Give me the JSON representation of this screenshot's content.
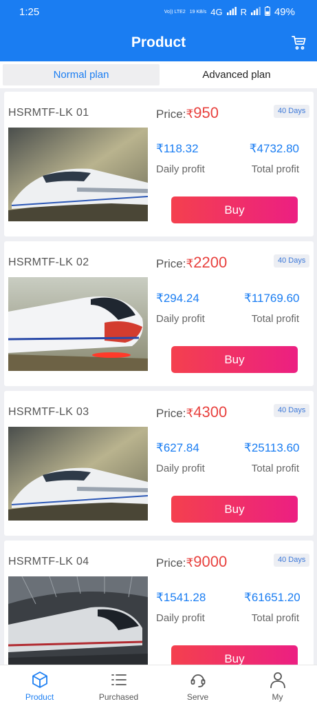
{
  "status": {
    "time": "1:25",
    "volte": "Vo)) LTE2",
    "speed": "19 KB/s",
    "network": "4G",
    "roaming": "R",
    "battery": "49%"
  },
  "header": {
    "title": "Product",
    "cart_icon": "cart-icon"
  },
  "tabs": [
    {
      "label": "Normal plan",
      "active": true
    },
    {
      "label": "Advanced plan",
      "active": false
    }
  ],
  "currency": "₹",
  "products": [
    {
      "name": "HSRMTF-LK 01",
      "price_label": "Price:",
      "price": "950",
      "days": "40 Days",
      "daily_profit": "118.32",
      "total_profit": "4732.80",
      "daily_label": "Daily profit",
      "total_label": "Total profit",
      "buy_label": "Buy"
    },
    {
      "name": "HSRMTF-LK 02",
      "price_label": "Price:",
      "price": "2200",
      "days": "40 Days",
      "daily_profit": "294.24",
      "total_profit": "11769.60",
      "daily_label": "Daily profit",
      "total_label": "Total profit",
      "buy_label": "Buy"
    },
    {
      "name": "HSRMTF-LK 03",
      "price_label": "Price:",
      "price": "4300",
      "days": "40 Days",
      "daily_profit": "627.84",
      "total_profit": "25113.60",
      "daily_label": "Daily profit",
      "total_label": "Total profit",
      "buy_label": "Buy"
    },
    {
      "name": "HSRMTF-LK 04",
      "price_label": "Price:",
      "price": "9000",
      "days": "40 Days",
      "daily_profit": "1541.28",
      "total_profit": "61651.20",
      "daily_label": "Daily profit",
      "total_label": "Total profit",
      "buy_label": "Buy"
    }
  ],
  "tabbar": [
    {
      "label": "Product",
      "icon": "cube-icon",
      "active": true
    },
    {
      "label": "Purchased",
      "icon": "list-icon",
      "active": false
    },
    {
      "label": "Serve",
      "icon": "headset-icon",
      "active": false
    },
    {
      "label": "My",
      "icon": "person-icon",
      "active": false
    }
  ],
  "colors": {
    "primary": "#1a7df2",
    "price": "#e8413e",
    "buy_start": "#f4404e",
    "buy_end": "#ec1f82"
  }
}
